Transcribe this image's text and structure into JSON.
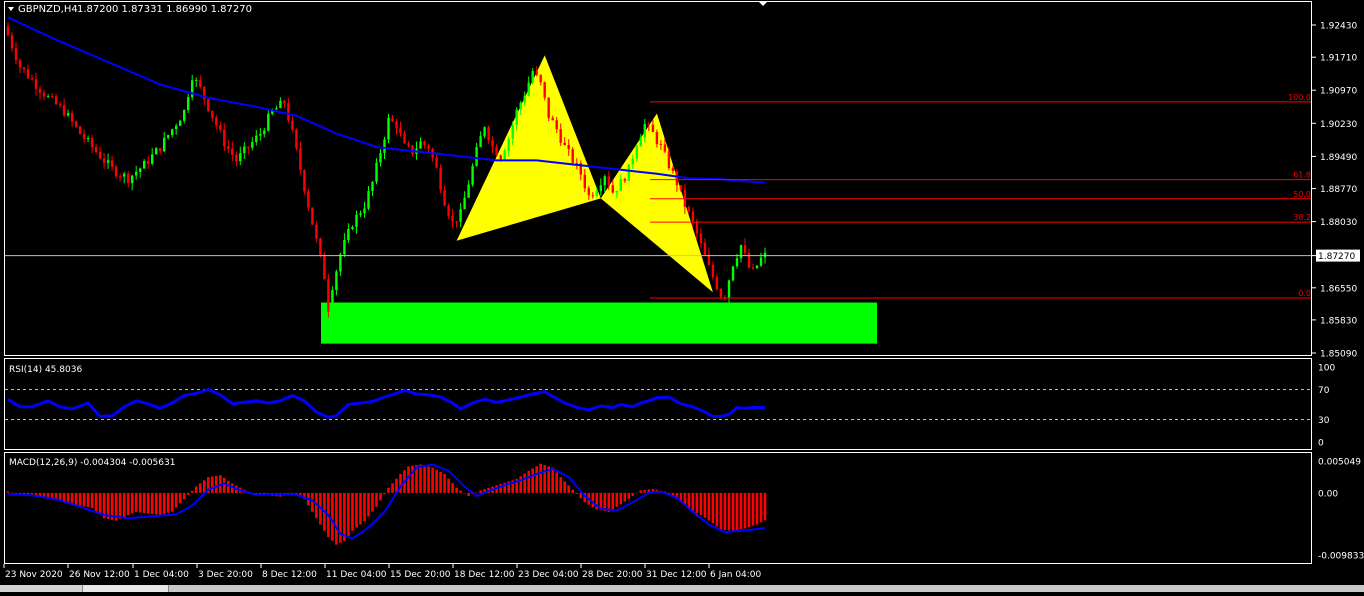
{
  "window": {
    "symbol_label": "GBPNZD,H4",
    "ohlc": "1.87200 1.87331 1.86990 1.87270"
  },
  "colors": {
    "background": "#000000",
    "axis": "#ffffff",
    "bull": "#00ff00",
    "bear": "#ff0000",
    "ma": "#0000ff",
    "harmonic": "#ffff00",
    "zone": "#00ff00",
    "fib": "#ff0000",
    "rsi": "#0000ff",
    "macd_hist": "#ff0000",
    "macd_signal": "#0000ff",
    "price_line": "#c0c0c0",
    "dash": "#c0c0c0"
  },
  "price_panel": {
    "ticks": [
      "1.92430",
      "1.91710",
      "1.90970",
      "1.90230",
      "1.89490",
      "1.88770",
      "1.88030",
      "1.87270",
      "1.86550",
      "1.85830",
      "1.85090"
    ],
    "current_price": "1.87270",
    "current_price_value": 1.8727,
    "fib_levels": [
      {
        "label": "100.0",
        "value": 1.9071
      },
      {
        "label": "61.8",
        "value": 1.8897
      },
      {
        "label": "50.0",
        "value": 1.8854
      },
      {
        "label": "38.2",
        "value": 1.8802
      },
      {
        "label": "0.0",
        "value": 1.8632
      }
    ],
    "demand_zone": {
      "from_date": "10 Dec 2020",
      "to_date": "8 Jan 2021",
      "low": 1.853,
      "high": 1.8622
    }
  },
  "rsi_panel": {
    "label": "RSI(14) 45.8036",
    "value": 45.8036,
    "levels": [
      70,
      30
    ],
    "ticks": [
      "100",
      "70",
      "30",
      "0"
    ]
  },
  "macd_panel": {
    "label": "MACD(12,26,9) -0.004304 -0.005631",
    "main": -0.004304,
    "signal": -0.005631,
    "ticks": [
      "0.005049",
      "0.00",
      "-0.009833"
    ]
  },
  "x_axis": {
    "labels": [
      "23 Nov 2020",
      "26 Nov 12:00",
      "1 Dec 04:00",
      "3 Dec 20:00",
      "8 Dec 12:00",
      "11 Dec 04:00",
      "15 Dec 20:00",
      "18 Dec 12:00",
      "23 Dec 04:00",
      "28 Dec 20:00",
      "31 Dec 12:00",
      "6 Jan 04:00"
    ]
  },
  "chart_data": {
    "type": "candlestick",
    "symbol": "GBPNZD",
    "timeframe": "H4",
    "x_labels": [
      "23 Nov 2020",
      "26 Nov 12:00",
      "1 Dec 04:00",
      "3 Dec 20:00",
      "8 Dec 12:00",
      "11 Dec 04:00",
      "15 Dec 20:00",
      "18 Dec 12:00",
      "23 Dec 04:00",
      "28 Dec 20:00",
      "31 Dec 12:00",
      "6 Jan 04:00"
    ],
    "ylim": [
      1.8485,
      1.9282
    ],
    "close_path": [
      [
        0,
        1.922
      ],
      [
        3,
        1.915
      ],
      [
        7,
        1.911
      ],
      [
        10,
        1.908
      ],
      [
        14,
        1.905
      ],
      [
        18,
        1.9
      ],
      [
        22,
        1.896
      ],
      [
        26,
        1.892
      ],
      [
        30,
        1.89
      ],
      [
        34,
        1.893
      ],
      [
        38,
        1.897
      ],
      [
        41,
        1.901
      ],
      [
        44,
        1.905
      ],
      [
        46,
        1.913
      ],
      [
        48,
        1.91
      ],
      [
        51,
        1.904
      ],
      [
        54,
        1.898
      ],
      [
        57,
        1.894
      ],
      [
        60,
        1.897
      ],
      [
        63,
        1.9
      ],
      [
        66,
        1.905
      ],
      [
        69,
        1.907
      ],
      [
        71,
        1.9
      ],
      [
        73,
        1.892
      ],
      [
        75,
        1.884
      ],
      [
        77,
        1.876
      ],
      [
        79,
        1.868
      ],
      [
        80,
        1.861
      ],
      [
        81,
        1.866
      ],
      [
        83,
        1.873
      ],
      [
        86,
        1.88
      ],
      [
        89,
        1.884
      ],
      [
        91,
        1.889
      ],
      [
        93,
        1.896
      ],
      [
        95,
        1.903
      ],
      [
        97,
        1.902
      ],
      [
        99,
        1.897
      ],
      [
        101,
        1.896
      ],
      [
        103,
        1.898
      ],
      [
        105,
        1.897
      ],
      [
        107,
        1.892
      ],
      [
        109,
        1.885
      ],
      [
        111,
        1.88
      ],
      [
        113,
        1.882
      ],
      [
        115,
        1.889
      ],
      [
        117,
        1.896
      ],
      [
        119,
        1.902
      ],
      [
        121,
        1.897
      ],
      [
        123,
        1.895
      ],
      [
        125,
        1.899
      ],
      [
        127,
        1.905
      ],
      [
        129,
        1.909
      ],
      [
        131,
        1.914
      ],
      [
        133,
        1.911
      ],
      [
        135,
        1.904
      ],
      [
        137,
        1.901
      ],
      [
        139,
        1.897
      ],
      [
        141,
        1.894
      ],
      [
        143,
        1.891
      ],
      [
        145,
        1.886
      ],
      [
        147,
        1.888
      ],
      [
        149,
        1.891
      ],
      [
        151,
        1.887
      ],
      [
        153,
        1.889
      ],
      [
        155,
        1.892
      ],
      [
        157,
        1.898
      ],
      [
        159,
        1.902
      ],
      [
        161,
        1.9
      ],
      [
        163,
        1.897
      ],
      [
        165,
        1.893
      ],
      [
        167,
        1.889
      ],
      [
        169,
        1.884
      ],
      [
        171,
        1.88
      ],
      [
        173,
        1.875
      ],
      [
        175,
        1.87
      ],
      [
        177,
        1.866
      ],
      [
        178,
        1.864
      ],
      [
        179,
        1.864
      ],
      [
        181,
        1.871
      ],
      [
        183,
        1.875
      ],
      [
        185,
        1.87
      ],
      [
        186,
        1.869
      ],
      [
        188,
        1.872
      ],
      [
        189,
        1.8727
      ]
    ],
    "ma_path": [
      [
        0,
        1.926
      ],
      [
        12,
        1.921
      ],
      [
        25,
        1.916
      ],
      [
        38,
        1.911
      ],
      [
        50,
        1.908
      ],
      [
        62,
        1.906
      ],
      [
        72,
        1.904
      ],
      [
        82,
        1.9
      ],
      [
        92,
        1.897
      ],
      [
        102,
        1.896
      ],
      [
        112,
        1.895
      ],
      [
        122,
        1.894
      ],
      [
        132,
        1.894
      ],
      [
        142,
        1.893
      ],
      [
        152,
        1.892
      ],
      [
        162,
        1.891
      ],
      [
        170,
        1.89
      ],
      [
        178,
        1.8898
      ],
      [
        189,
        1.889
      ]
    ],
    "harmonic_patterns": [
      {
        "points": [
          [
            112,
            1.876
          ],
          [
            134,
            1.9175
          ],
          [
            148,
            1.8855
          ],
          [
            112,
            1.876
          ]
        ]
      },
      {
        "points": [
          [
            148,
            1.8855
          ],
          [
            162,
            1.9045
          ],
          [
            176,
            1.8645
          ],
          [
            148,
            1.8855
          ]
        ]
      }
    ]
  },
  "rsi_data": {
    "path": [
      [
        0,
        57
      ],
      [
        3,
        47
      ],
      [
        6,
        47
      ],
      [
        10,
        55
      ],
      [
        13,
        47
      ],
      [
        16,
        44
      ],
      [
        20,
        52
      ],
      [
        23,
        34
      ],
      [
        26,
        35
      ],
      [
        29,
        47
      ],
      [
        32,
        55
      ],
      [
        35,
        51
      ],
      [
        38,
        45
      ],
      [
        41,
        52
      ],
      [
        44,
        62
      ],
      [
        47,
        65
      ],
      [
        50,
        70
      ],
      [
        53,
        63
      ],
      [
        56,
        51
      ],
      [
        59,
        53
      ],
      [
        62,
        55
      ],
      [
        65,
        52
      ],
      [
        68,
        55
      ],
      [
        71,
        62
      ],
      [
        74,
        55
      ],
      [
        77,
        40
      ],
      [
        80,
        33
      ],
      [
        82,
        35
      ],
      [
        85,
        50
      ],
      [
        88,
        52
      ],
      [
        91,
        54
      ],
      [
        94,
        60
      ],
      [
        97,
        65
      ],
      [
        99,
        69
      ],
      [
        102,
        64
      ],
      [
        105,
        63
      ],
      [
        108,
        60
      ],
      [
        111,
        52
      ],
      [
        113,
        44
      ],
      [
        116,
        52
      ],
      [
        119,
        57
      ],
      [
        122,
        53
      ],
      [
        125,
        56
      ],
      [
        128,
        60
      ],
      [
        131,
        64
      ],
      [
        134,
        67
      ],
      [
        136,
        61
      ],
      [
        139,
        52
      ],
      [
        142,
        46
      ],
      [
        145,
        43
      ],
      [
        148,
        48
      ],
      [
        151,
        46
      ],
      [
        153,
        50
      ],
      [
        156,
        47
      ],
      [
        158,
        52
      ],
      [
        160,
        55
      ],
      [
        162,
        59
      ],
      [
        165,
        60
      ],
      [
        168,
        51
      ],
      [
        171,
        47
      ],
      [
        174,
        40
      ],
      [
        176,
        34
      ],
      [
        178,
        34
      ],
      [
        180,
        37
      ],
      [
        182,
        46
      ],
      [
        184,
        45
      ],
      [
        186,
        46
      ],
      [
        189,
        46
      ]
    ]
  },
  "macd_data": {
    "hist": [
      [
        0,
        0.0002
      ],
      [
        3,
        -0.0003
      ],
      [
        6,
        -0.0002
      ],
      [
        9,
        -0.0008
      ],
      [
        12,
        -0.0012
      ],
      [
        15,
        -0.0015
      ],
      [
        18,
        -0.002
      ],
      [
        21,
        -0.0024
      ],
      [
        24,
        -0.004
      ],
      [
        27,
        -0.0044
      ],
      [
        29,
        -0.0038
      ],
      [
        32,
        -0.003
      ],
      [
        35,
        -0.0033
      ],
      [
        38,
        -0.0035
      ],
      [
        41,
        -0.003
      ],
      [
        44,
        -0.001
      ],
      [
        47,
        0.001
      ],
      [
        50,
        0.0025
      ],
      [
        53,
        0.0028
      ],
      [
        56,
        0.0015
      ],
      [
        59,
        0.0005
      ],
      [
        62,
        -0.0004
      ],
      [
        65,
        -0.0004
      ],
      [
        68,
        -0.0006
      ],
      [
        71,
        -0.0001
      ],
      [
        74,
        -0.001
      ],
      [
        77,
        -0.004
      ],
      [
        80,
        -0.007
      ],
      [
        82,
        -0.0082
      ],
      [
        84,
        -0.0076
      ],
      [
        86,
        -0.006
      ],
      [
        89,
        -0.0045
      ],
      [
        92,
        -0.0022
      ],
      [
        95,
        0.0008
      ],
      [
        98,
        0.003
      ],
      [
        100,
        0.0042
      ],
      [
        103,
        0.0045
      ],
      [
        106,
        0.004
      ],
      [
        109,
        0.003
      ],
      [
        112,
        0.0008
      ],
      [
        115,
        -0.0005
      ],
      [
        118,
        0.0004
      ],
      [
        121,
        0.001
      ],
      [
        124,
        0.0016
      ],
      [
        127,
        0.0022
      ],
      [
        130,
        0.0035
      ],
      [
        133,
        0.0046
      ],
      [
        136,
        0.004
      ],
      [
        138,
        0.0025
      ],
      [
        141,
        0.0005
      ],
      [
        144,
        -0.0015
      ],
      [
        147,
        -0.0026
      ],
      [
        150,
        -0.003
      ],
      [
        153,
        -0.0018
      ],
      [
        156,
        -0.0005
      ],
      [
        158,
        0.0004
      ],
      [
        161,
        0.0006
      ],
      [
        164,
        0.0002
      ],
      [
        167,
        -0.001
      ],
      [
        170,
        -0.0025
      ],
      [
        173,
        -0.0035
      ],
      [
        176,
        -0.0048
      ],
      [
        178,
        -0.0058
      ],
      [
        181,
        -0.006
      ],
      [
        184,
        -0.0056
      ],
      [
        187,
        -0.005
      ],
      [
        189,
        -0.0043
      ]
    ],
    "signal": [
      [
        0,
        -0.0002
      ],
      [
        6,
        -0.0004
      ],
      [
        12,
        -0.001
      ],
      [
        18,
        -0.0022
      ],
      [
        24,
        -0.0035
      ],
      [
        30,
        -0.004
      ],
      [
        36,
        -0.0037
      ],
      [
        42,
        -0.0034
      ],
      [
        46,
        -0.002
      ],
      [
        50,
        0.0005
      ],
      [
        54,
        0.0015
      ],
      [
        58,
        0.0004
      ],
      [
        62,
        -0.0003
      ],
      [
        68,
        -0.0002
      ],
      [
        72,
        -0.0003
      ],
      [
        76,
        -0.0012
      ],
      [
        80,
        -0.0035
      ],
      [
        83,
        -0.0065
      ],
      [
        86,
        -0.0072
      ],
      [
        90,
        -0.0055
      ],
      [
        94,
        -0.003
      ],
      [
        98,
        0.001
      ],
      [
        102,
        0.004
      ],
      [
        106,
        0.0045
      ],
      [
        110,
        0.0035
      ],
      [
        114,
        0.001
      ],
      [
        117,
        -0.0005
      ],
      [
        120,
        0.0003
      ],
      [
        124,
        0.0012
      ],
      [
        128,
        0.002
      ],
      [
        132,
        0.003
      ],
      [
        136,
        0.0038
      ],
      [
        140,
        0.0025
      ],
      [
        144,
        -0.0005
      ],
      [
        148,
        -0.0025
      ],
      [
        152,
        -0.0028
      ],
      [
        156,
        -0.0015
      ],
      [
        160,
        0.0
      ],
      [
        163,
        0.0002
      ],
      [
        167,
        -0.0008
      ],
      [
        171,
        -0.003
      ],
      [
        175,
        -0.005
      ],
      [
        179,
        -0.0062
      ],
      [
        183,
        -0.006
      ],
      [
        189,
        -0.0056
      ]
    ]
  }
}
